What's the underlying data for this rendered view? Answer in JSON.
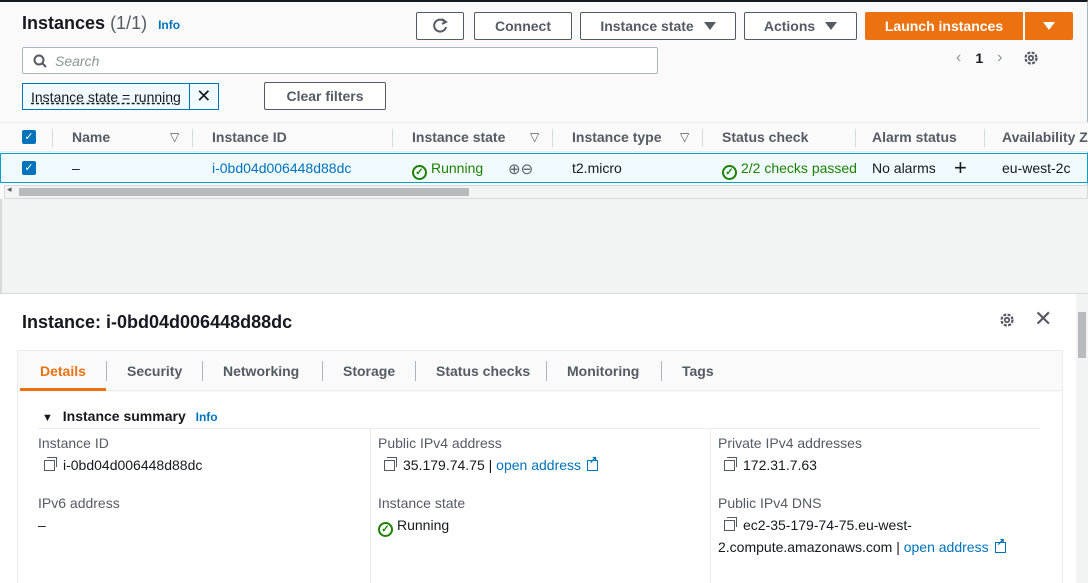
{
  "header": {
    "title": "Instances",
    "count": "(1/1)",
    "info": "Info",
    "buttons": {
      "refresh_icon": "refresh-icon",
      "connect": "Connect",
      "instance_state": "Instance state",
      "actions": "Actions",
      "launch": "Launch instances"
    }
  },
  "search": {
    "placeholder": "Search"
  },
  "pagination": {
    "page": "1"
  },
  "filter": {
    "chip": "Instance state = running",
    "clear": "Clear filters"
  },
  "table": {
    "columns": [
      "Name",
      "Instance ID",
      "Instance state",
      "Instance type",
      "Status check",
      "Alarm status",
      "Availability Z"
    ],
    "row": {
      "name": "–",
      "instance_id": "i-0bd04d006448d88dc",
      "state": "Running",
      "type": "t2.micro",
      "status_check": "2/2 checks passed",
      "alarm": "No alarms",
      "az": "eu-west-2c"
    }
  },
  "details": {
    "title": "Instance: i-0bd04d006448d88dc",
    "tabs": [
      "Details",
      "Security",
      "Networking",
      "Storage",
      "Status checks",
      "Monitoring",
      "Tags"
    ],
    "summary_title": "Instance summary",
    "summary_info": "Info",
    "fields": {
      "instance_id_label": "Instance ID",
      "instance_id": "i-0bd04d006448d88dc",
      "ipv6_label": "IPv6 address",
      "ipv6": "–",
      "public_ipv4_label": "Public IPv4 address",
      "public_ipv4": "35.179.74.75",
      "open_address": "open address",
      "instance_state_label": "Instance state",
      "instance_state": "Running",
      "private_ipv4_label": "Private IPv4 addresses",
      "private_ipv4": "172.31.7.63",
      "public_dns_label": "Public IPv4 DNS",
      "public_dns_line1": "ec2-35-179-74-75.eu-west-",
      "public_dns_line2": "2.compute.amazonaws.com |"
    }
  },
  "colors": {
    "accent": "#ec7211",
    "link": "#0073bb",
    "success": "#1d8102"
  }
}
